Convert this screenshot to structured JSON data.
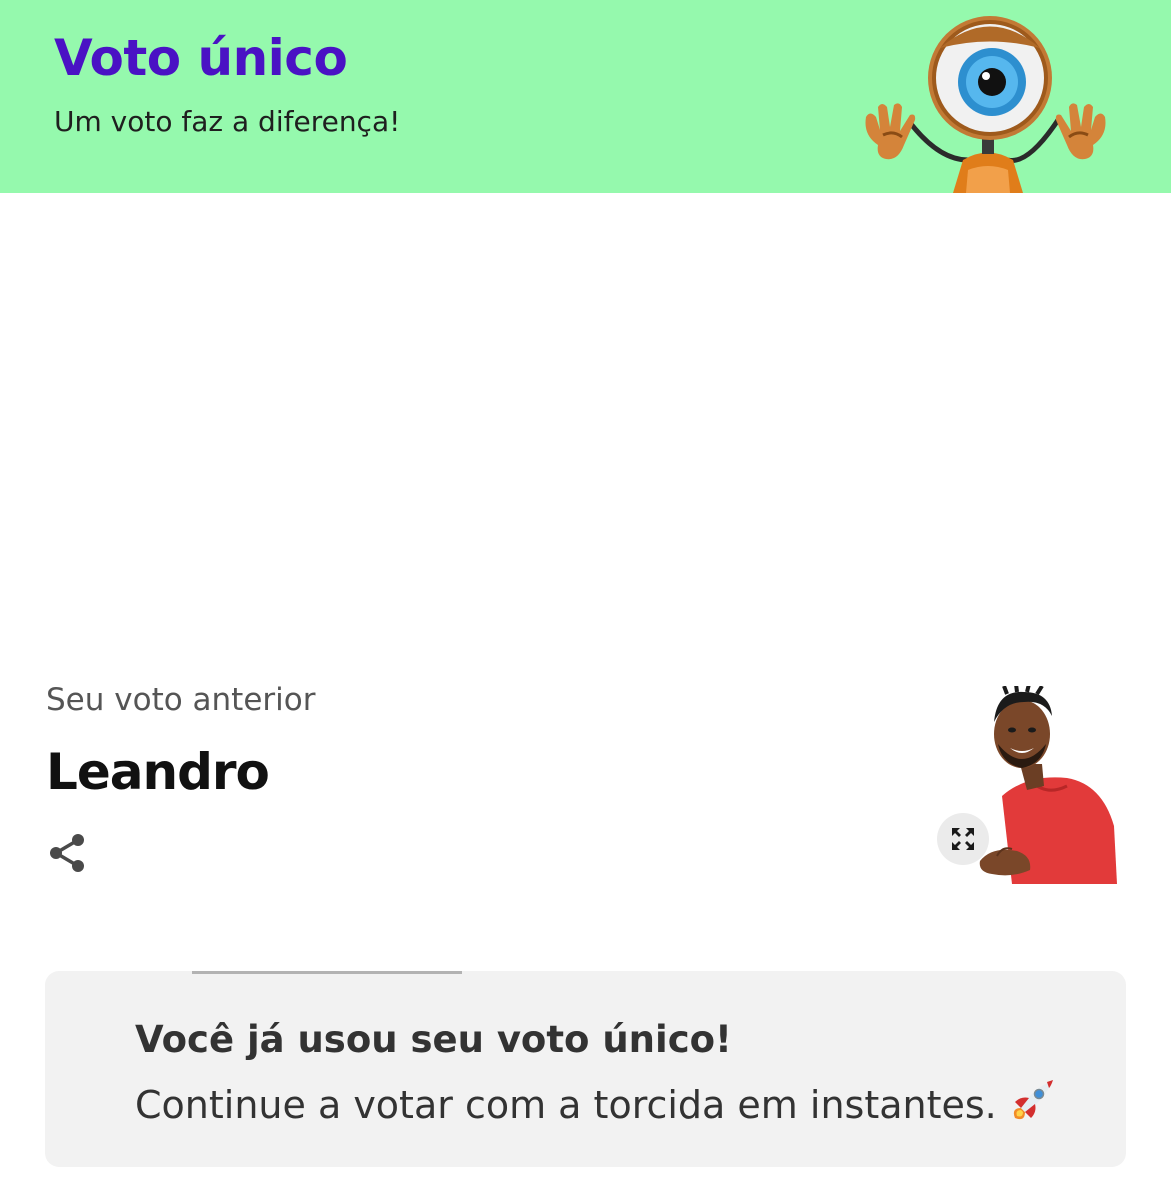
{
  "header": {
    "title": "Voto único",
    "subtitle": "Um voto faz a diferença!",
    "mascot_icon": "big-brother-eye-robot-mascot",
    "background_color": "#95f9ad",
    "title_color": "#4a12c4"
  },
  "previous_vote": {
    "label": "Seu voto anterior",
    "name": "Leandro",
    "share_icon": "share-icon",
    "expand_icon": "expand-icon",
    "photo": "participant-photo-leandro"
  },
  "notice": {
    "title": "Você já usou seu voto único!",
    "text": "Continue a votar com a torcida em instantes.",
    "emoji_icon": "rocket-icon"
  }
}
